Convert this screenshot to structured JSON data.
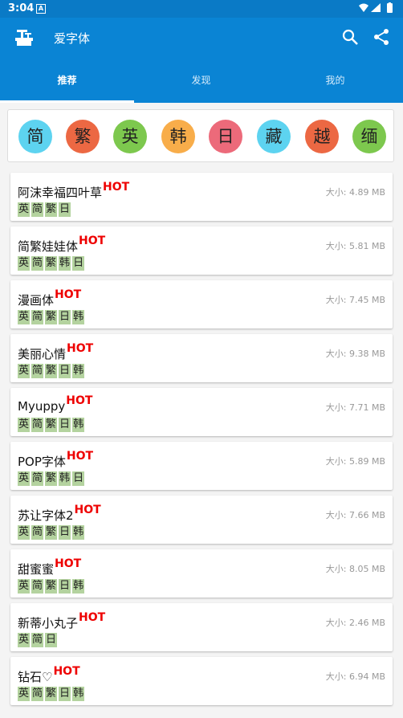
{
  "status": {
    "time": "3:04",
    "notif_glyph": "A"
  },
  "appbar": {
    "title": "爱字体",
    "search_icon": "search-icon",
    "share_icon": "share-icon"
  },
  "tabs": [
    {
      "label": "推荐",
      "active": true
    },
    {
      "label": "发现",
      "active": false
    },
    {
      "label": "我的",
      "active": false
    }
  ],
  "filters": [
    {
      "label": "简",
      "color": "#5dd3f0"
    },
    {
      "label": "繁",
      "color": "#ec6843"
    },
    {
      "label": "英",
      "color": "#7dc84e"
    },
    {
      "label": "韩",
      "color": "#f8ad4a"
    },
    {
      "label": "日",
      "color": "#ec6a7a"
    },
    {
      "label": "藏",
      "color": "#5dd3f0"
    },
    {
      "label": "越",
      "color": "#ec6843"
    },
    {
      "label": "缅",
      "color": "#7dc84e"
    }
  ],
  "hot_label": "HOT",
  "fonts": [
    {
      "name": "阿沫幸福四叶草",
      "size": "大小: 4.89 MB",
      "tags": [
        "英",
        "简",
        "繁",
        "日"
      ]
    },
    {
      "name": "简繁娃娃体",
      "size": "大小: 5.81 MB",
      "tags": [
        "英",
        "简",
        "繁",
        "韩",
        "日"
      ]
    },
    {
      "name": "漫画体",
      "size": "大小: 7.45 MB",
      "tags": [
        "英",
        "简",
        "繁",
        "日",
        "韩"
      ]
    },
    {
      "name": "美丽心情",
      "size": "大小: 9.38 MB",
      "tags": [
        "英",
        "简",
        "繁",
        "日",
        "韩"
      ]
    },
    {
      "name": "Myuppy",
      "size": "大小: 7.71 MB",
      "tags": [
        "英",
        "简",
        "繁",
        "日",
        "韩"
      ]
    },
    {
      "name": "POP字体",
      "size": "大小: 5.89 MB",
      "tags": [
        "英",
        "简",
        "繁",
        "韩",
        "日"
      ]
    },
    {
      "name": "苏让字体2",
      "size": "大小: 7.66 MB",
      "tags": [
        "英",
        "简",
        "繁",
        "日",
        "韩"
      ]
    },
    {
      "name": "甜蜜蜜",
      "size": "大小: 8.05 MB",
      "tags": [
        "英",
        "简",
        "繁",
        "日",
        "韩"
      ]
    },
    {
      "name": "新蒂小丸子",
      "size": "大小: 2.46 MB",
      "tags": [
        "英",
        "简",
        "日"
      ]
    },
    {
      "name": "钻石♡",
      "size": "大小: 6.94 MB",
      "tags": [
        "英",
        "简",
        "繁",
        "日",
        "韩"
      ]
    }
  ]
}
